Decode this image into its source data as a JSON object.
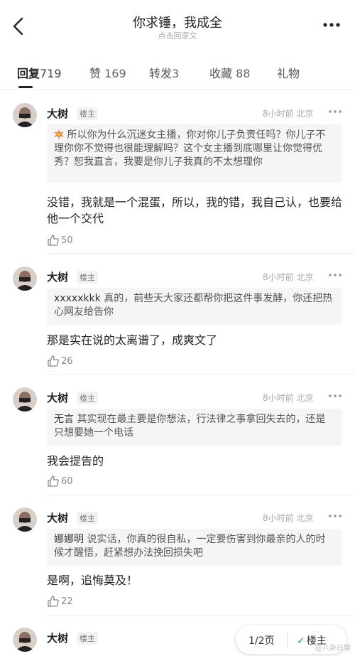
{
  "header": {
    "title": "你求锤，我成全",
    "subtitle": "点击回原文"
  },
  "tabs": [
    {
      "label": "回复",
      "count": "719",
      "active": true
    },
    {
      "label": "赞",
      "count": "169"
    },
    {
      "label": "转发",
      "count": "3"
    },
    {
      "label": "收藏",
      "count": "88"
    },
    {
      "label": "礼物",
      "count": ""
    }
  ],
  "comments": [
    {
      "user": "大树",
      "badge": "楼主",
      "time": "8小时前",
      "location": "北京",
      "quote_name": "",
      "quote_text": "所以你为什么沉迷女主播，你对你儿子负责任吗？你儿子不理你你不觉得也很能理解吗？这个女主播到底哪里让你觉得优秀？恕我直言，我要是你儿子我真的不太想理你",
      "reply": "没错，我就是一个混蛋，所以，我的错，我自己认，也要给他一个交代",
      "likes": "50"
    },
    {
      "user": "大树",
      "badge": "楼主",
      "time": "8小时前",
      "location": "北京",
      "quote_name": "xxxxxkkk",
      "quote_text": "真的，前些天大家还都帮你把这件事发酵，你还把热心网友给告你",
      "reply": "那是实在说的太离谱了，成爽文了",
      "likes": "26"
    },
    {
      "user": "大树",
      "badge": "楼主",
      "time": "8小时前",
      "location": "北京",
      "quote_name": "无言",
      "quote_text": "其实现在最主要是你想法，行法律之事拿回失去的，还是只想要她一个电话",
      "reply": "我会提告的",
      "likes": "60"
    },
    {
      "user": "大树",
      "badge": "楼主",
      "time": "8小时前",
      "location": "北京",
      "quote_name": "娜娜明",
      "quote_text": "说实话，你真的很自私，一定要伤害到你最亲的人的时候才醒悟，赶紧想办法挽回损失吧",
      "reply": "是啊，追悔莫及！",
      "likes": "22"
    },
    {
      "user": "大树",
      "badge": "楼主"
    }
  ],
  "pager": {
    "page": "1/2页",
    "op_filter": "楼主"
  },
  "watermark": "@八卦日常",
  "colors": {
    "accent_green": "#2aa84a",
    "quote_bg": "#f5f5f5"
  }
}
